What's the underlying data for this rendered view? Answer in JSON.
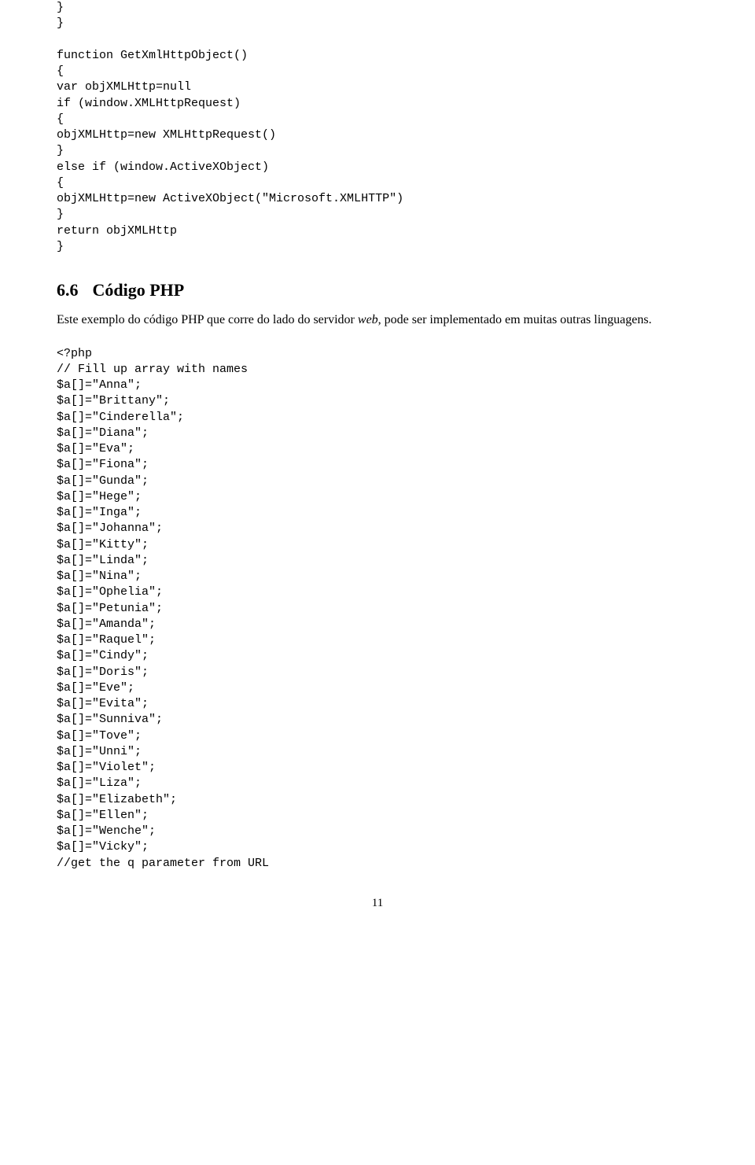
{
  "code1": {
    "lines": [
      "}",
      "}",
      "",
      "function GetXmlHttpObject()",
      "{",
      "var objXMLHttp=null",
      "if (window.XMLHttpRequest)",
      "{",
      "objXMLHttp=new XMLHttpRequest()",
      "}",
      "else if (window.ActiveXObject)",
      "{",
      "objXMLHttp=new ActiveXObject(\"Microsoft.XMLHTTP\")",
      "}",
      "return objXMLHttp",
      "}"
    ]
  },
  "section": {
    "number": "6.6",
    "title": "Código PHP"
  },
  "paragraph": {
    "pre": "Este exemplo do código PHP que corre do lado do servidor ",
    "em": "web",
    "post": ", pode ser implementado em muitas outras linguagens."
  },
  "code2": {
    "lines": [
      "<?php",
      "// Fill up array with names",
      "$a[]=\"Anna\";",
      "$a[]=\"Brittany\";",
      "$a[]=\"Cinderella\";",
      "$a[]=\"Diana\";",
      "$a[]=\"Eva\";",
      "$a[]=\"Fiona\";",
      "$a[]=\"Gunda\";",
      "$a[]=\"Hege\";",
      "$a[]=\"Inga\";",
      "$a[]=\"Johanna\";",
      "$a[]=\"Kitty\";",
      "$a[]=\"Linda\";",
      "$a[]=\"Nina\";",
      "$a[]=\"Ophelia\";",
      "$a[]=\"Petunia\";",
      "$a[]=\"Amanda\";",
      "$a[]=\"Raquel\";",
      "$a[]=\"Cindy\";",
      "$a[]=\"Doris\";",
      "$a[]=\"Eve\";",
      "$a[]=\"Evita\";",
      "$a[]=\"Sunniva\";",
      "$a[]=\"Tove\";",
      "$a[]=\"Unni\";",
      "$a[]=\"Violet\";",
      "$a[]=\"Liza\";",
      "$a[]=\"Elizabeth\";",
      "$a[]=\"Ellen\";",
      "$a[]=\"Wenche\";",
      "$a[]=\"Vicky\";",
      "//get the q parameter from URL"
    ]
  },
  "page_number": "11"
}
